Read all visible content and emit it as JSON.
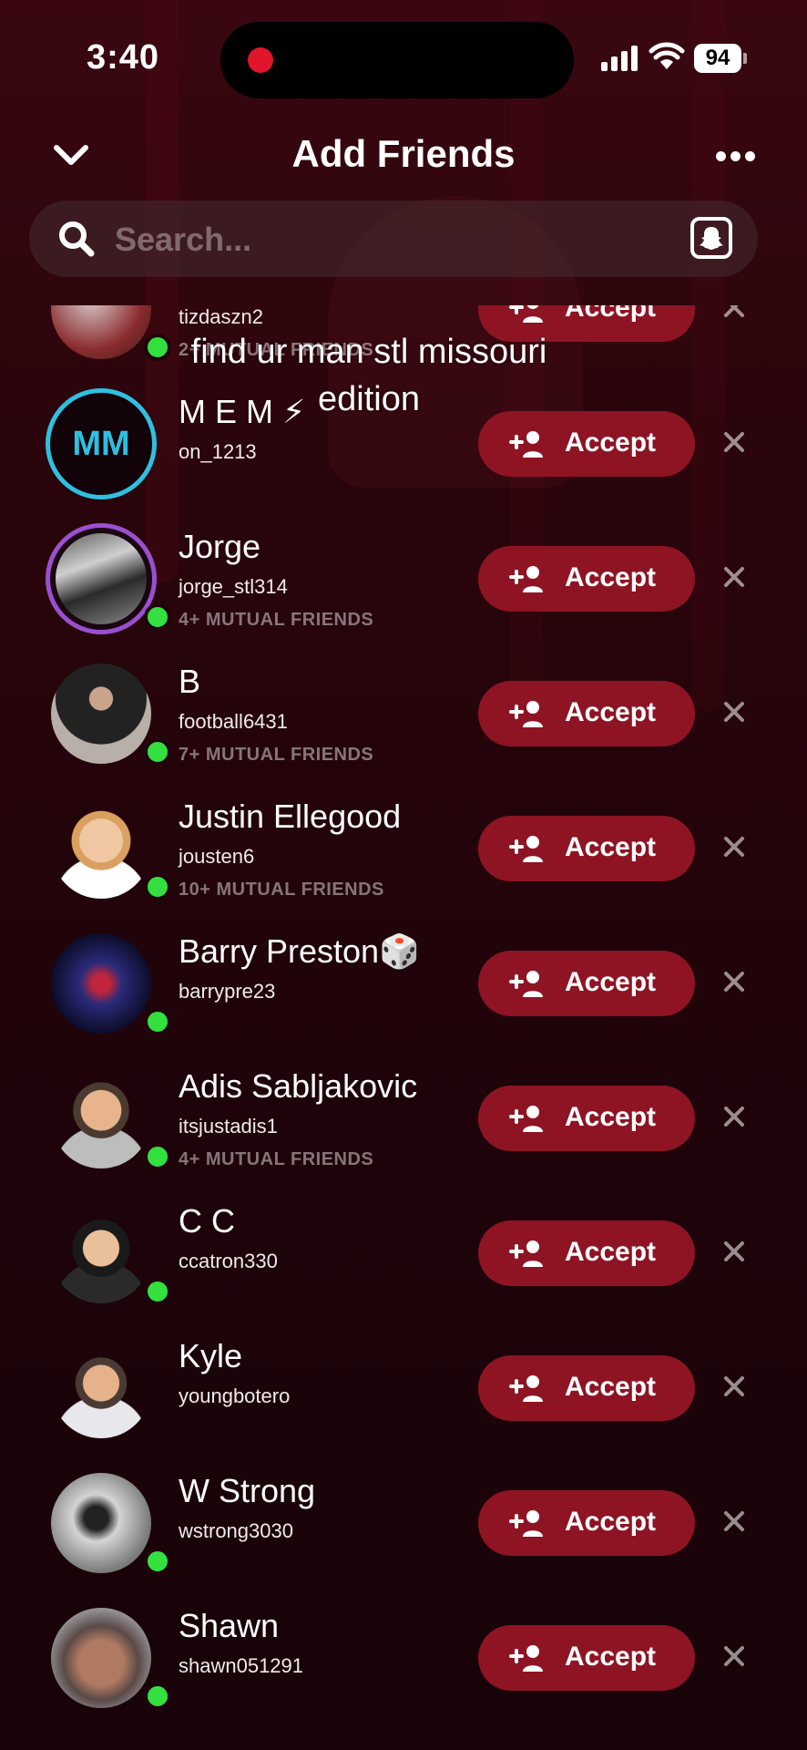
{
  "status_bar": {
    "time": "3:40",
    "battery": "94"
  },
  "header": {
    "title": "Add Friends"
  },
  "search": {
    "placeholder": "Search..."
  },
  "overlay_caption": "find ur man stl missouri edition",
  "accept_label": "Accept",
  "requests": [
    {
      "name": "",
      "username": "tizdaszn2",
      "mutual": "2+ MUTUAL FRIENDS"
    },
    {
      "name": "M E M ⚡",
      "username": "on_1213",
      "mutual": "",
      "initials": "MM"
    },
    {
      "name": "Jorge",
      "username": "jorge_stl314",
      "mutual": "4+ MUTUAL FRIENDS"
    },
    {
      "name": "B",
      "username": "football6431",
      "mutual": "7+ MUTUAL FRIENDS"
    },
    {
      "name": "Justin Ellegood",
      "username": "jousten6",
      "mutual": "10+ MUTUAL FRIENDS"
    },
    {
      "name": "Barry Preston🎲",
      "username": "barrypre23",
      "mutual": ""
    },
    {
      "name": "Adis Sabljakovic",
      "username": "itsjustadis1",
      "mutual": "4+ MUTUAL FRIENDS"
    },
    {
      "name": "C C",
      "username": "ccatron330",
      "mutual": ""
    },
    {
      "name": "Kyle",
      "username": "youngbotero",
      "mutual": ""
    },
    {
      "name": "W Strong",
      "username": "wstrong3030",
      "mutual": ""
    },
    {
      "name": "Shawn",
      "username": "shawn051291",
      "mutual": ""
    }
  ],
  "colors": {
    "accept_bg": "#8e1424",
    "online": "#33e03f",
    "ring_blue": "#2ec0e0",
    "ring_purple": "#9b4fd0"
  }
}
